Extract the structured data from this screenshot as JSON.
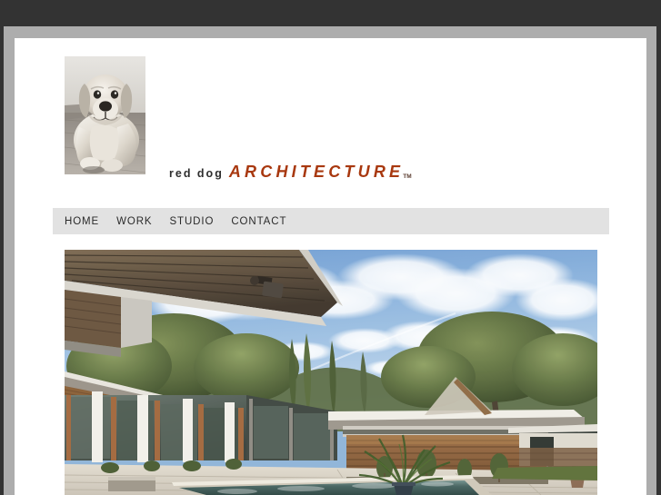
{
  "window": {
    "chrome_color": "#333333",
    "frame_color": "#adadad",
    "canvas_color": "#ffffff"
  },
  "header": {
    "logo_photo_alt": "red-dog-labrador-photo",
    "wordmark": {
      "primary": "red dog",
      "primary_color": "#2e2e2e",
      "secondary": "ARCHITECTURE",
      "secondary_color": "#a8380f",
      "trademark": "TM"
    }
  },
  "nav": {
    "background_color": "#e2e2e2",
    "items": [
      {
        "label": "HOME",
        "name": "nav-item-home"
      },
      {
        "label": "WORK",
        "name": "nav-item-work"
      },
      {
        "label": "STUDIO",
        "name": "nav-item-studio"
      },
      {
        "label": "CONTACT",
        "name": "nav-item-contact"
      }
    ]
  },
  "hero": {
    "alt": "modern-house-courtyard-with-swimming-pool",
    "sky_color": "#8fb4d8",
    "pool_color": "#4e6e6a",
    "deck_color": "#d8d2c6",
    "wood_color": "#8a6642",
    "foliage_color": "#5a6b3f"
  }
}
